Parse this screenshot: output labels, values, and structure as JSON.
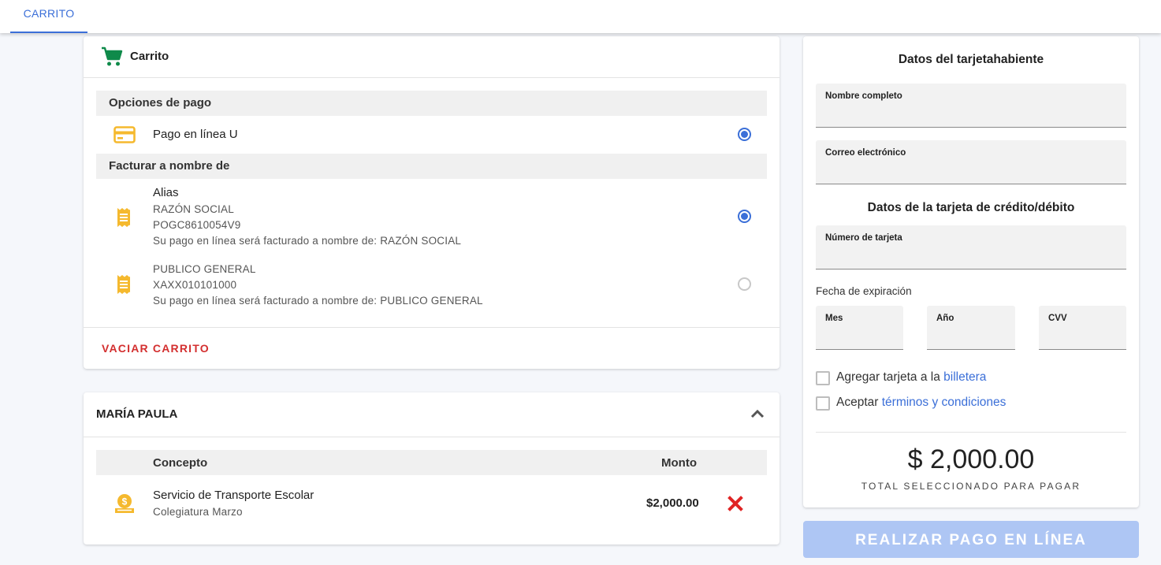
{
  "tabs": [
    {
      "label": "CARRITO"
    }
  ],
  "cart": {
    "title": "Carrito",
    "payment_options_title": "Opciones de pago",
    "payment_option_label": "Pago en línea U",
    "billing_title": "Facturar a nombre de",
    "billing_options": [
      {
        "alias": "Alias",
        "name": "RAZÓN SOCIAL",
        "rfc": "POGC8610054V9",
        "note": "Su pago en línea será facturado a nombre de: RAZÓN SOCIAL",
        "selected": true
      },
      {
        "alias": "",
        "name": "PUBLICO GENERAL",
        "rfc": "XAXX010101000",
        "note": "Su pago en línea será facturado a nombre de: PUBLICO GENERAL",
        "selected": false
      }
    ],
    "empty_cart_label": "VACIAR CARRITO"
  },
  "student": {
    "name": "MARÍA PAULA",
    "columns": {
      "concept": "Concepto",
      "amount": "Monto"
    },
    "items": [
      {
        "concept": "Servicio de Transporte Escolar",
        "detail": "Colegiatura Marzo",
        "amount": "$2,000.00"
      }
    ]
  },
  "payment_form": {
    "cardholder_title": "Datos del tarjetahabiente",
    "full_name_label": "Nombre completo",
    "email_label": "Correo electrónico",
    "card_title": "Datos de la tarjeta de crédito/débito",
    "card_number_label": "Número de tarjeta",
    "expiration_label": "Fecha de expiración",
    "month_label": "Mes",
    "year_label": "Año",
    "cvv_label": "CVV",
    "wallet_text": "Agregar tarjeta a la ",
    "wallet_link": "billetera",
    "terms_text": "Aceptar ",
    "terms_link": "términos y condiciones",
    "total": "$ 2,000.00",
    "total_caption": "TOTAL SELECCIONADO PARA PAGAR",
    "pay_button": "REALIZAR PAGO EN LÍNEA"
  },
  "colors": {
    "accent": "#3b6fd8",
    "icon_green": "#0f8a4a",
    "icon_amber": "#f5b92e",
    "danger": "#d32f2f"
  }
}
